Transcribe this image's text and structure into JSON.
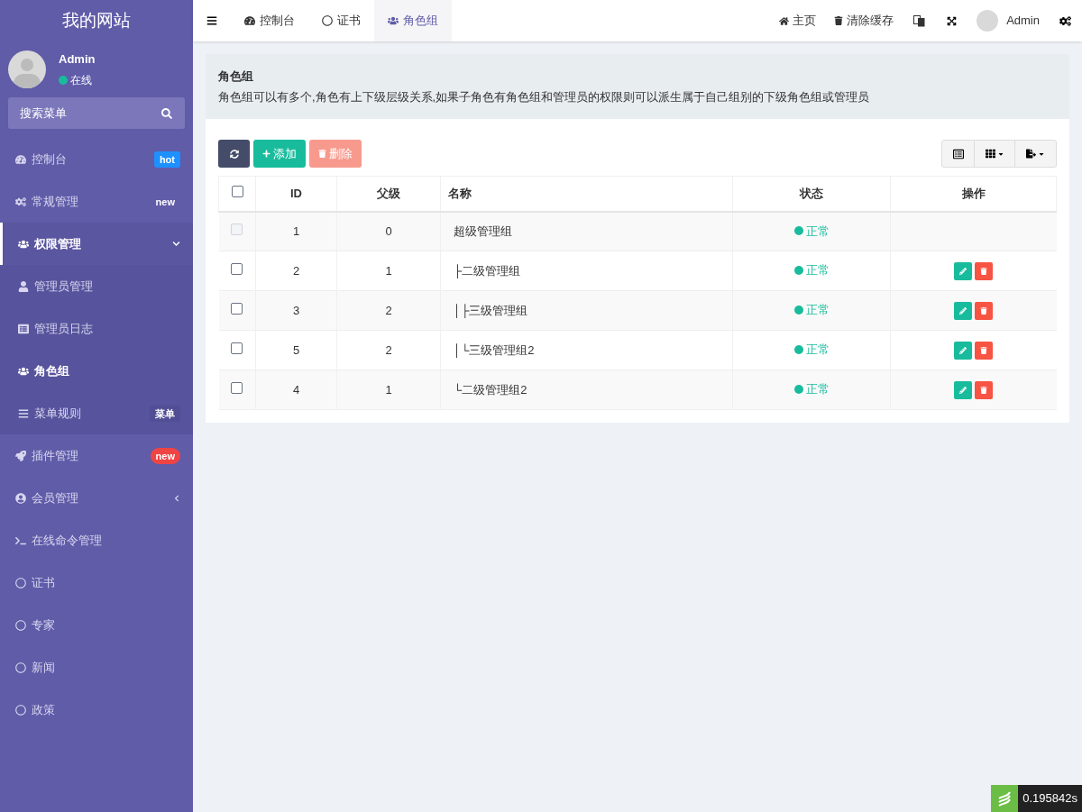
{
  "site_title": "我的网站",
  "user": {
    "name": "Admin",
    "status": "在线",
    "online": true
  },
  "search": {
    "placeholder": "搜索菜单"
  },
  "sidebar": {
    "items": [
      {
        "label": "控制台",
        "badge": {
          "text": "hot",
          "color": "#1e90ff"
        },
        "selected": false,
        "expanded": false,
        "has_children": false
      },
      {
        "label": "常规管理",
        "badge": {
          "text": "new"
        },
        "selected": false,
        "expanded": false,
        "has_children": false
      },
      {
        "label": "权限管理",
        "selected": true,
        "expanded": true,
        "has_children": true,
        "children": [
          {
            "label": "管理员管理",
            "selected": false
          },
          {
            "label": "管理员日志",
            "selected": false
          },
          {
            "label": "角色组",
            "selected": true
          },
          {
            "label": "菜单规则",
            "badge": {
              "text": "菜单",
              "color": "#514e95"
            },
            "selected": false
          }
        ]
      },
      {
        "label": "插件管理",
        "badge": {
          "text": "new",
          "color": "#ef4444"
        },
        "selected": false,
        "expanded": false,
        "has_children": false
      },
      {
        "label": "会员管理",
        "selected": false,
        "expanded": false,
        "has_children": true
      },
      {
        "label": "在线命令管理",
        "selected": false,
        "expanded": false,
        "has_children": false
      },
      {
        "label": "证书",
        "selected": false,
        "expanded": false,
        "has_children": false
      },
      {
        "label": "专家",
        "selected": false,
        "expanded": false,
        "has_children": false
      },
      {
        "label": "新闻",
        "selected": false,
        "expanded": false,
        "has_children": false
      },
      {
        "label": "政策",
        "selected": false,
        "expanded": false,
        "has_children": false
      }
    ]
  },
  "tabs": [
    {
      "label": "控制台",
      "selected": false
    },
    {
      "label": "证书",
      "selected": false
    },
    {
      "label": "角色组",
      "selected": true
    }
  ],
  "header_links": [
    {
      "label": "主页"
    },
    {
      "label": "清除缓存"
    }
  ],
  "header_user": "Admin",
  "panel": {
    "title": "角色组",
    "description": "角色组可以有多个,角色有上下级层级关系,如果子角色有角色组和管理员的权限则可以派生属于自己组别的下级角色组或管理员"
  },
  "toolbar": {
    "add": "添加",
    "delete": "删除",
    "delete_disabled": true
  },
  "table": {
    "columns": [
      "ID",
      "父级",
      "名称",
      "状态",
      "操作"
    ],
    "header_checked": false,
    "rows": [
      {
        "id": "1",
        "parent": "0",
        "name": "超级管理组",
        "status": "正常",
        "checked": false,
        "disabled": true,
        "editable": false
      },
      {
        "id": "2",
        "parent": "1",
        "name": "├二级管理组",
        "status": "正常",
        "checked": false,
        "disabled": false,
        "editable": true
      },
      {
        "id": "3",
        "parent": "2",
        "name": "│├三级管理组",
        "status": "正常",
        "checked": false,
        "disabled": false,
        "editable": true
      },
      {
        "id": "5",
        "parent": "2",
        "name": "│└三级管理组2",
        "status": "正常",
        "checked": false,
        "disabled": false,
        "editable": true
      },
      {
        "id": "4",
        "parent": "1",
        "name": "└二级管理组2",
        "status": "正常",
        "checked": false,
        "disabled": false,
        "editable": true
      }
    ]
  },
  "trace": "0.195842s"
}
